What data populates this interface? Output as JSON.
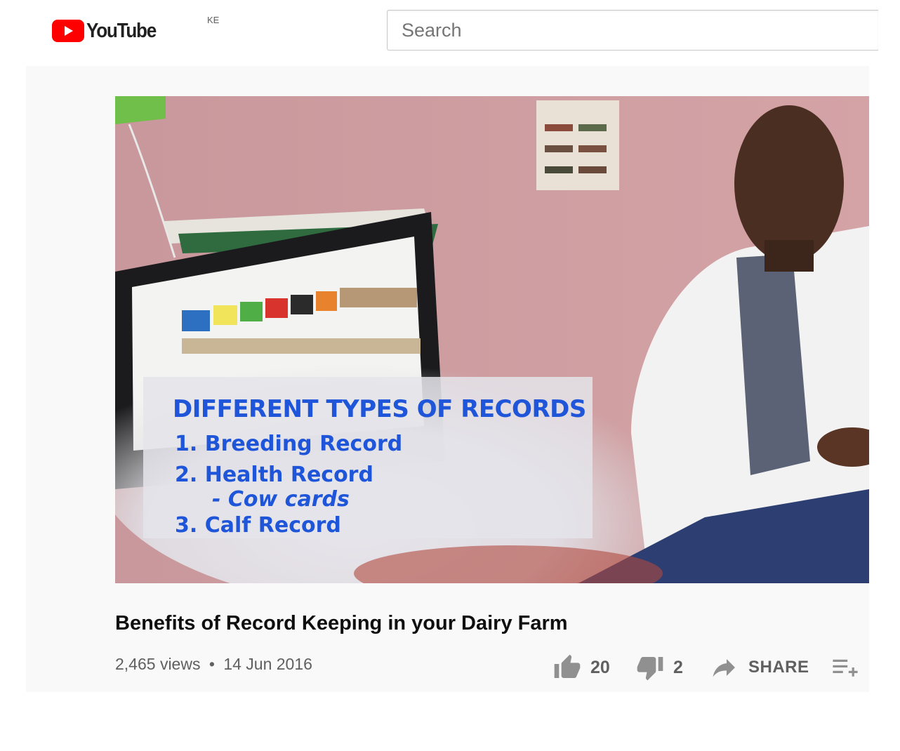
{
  "header": {
    "logo_text": "YouTube",
    "country_code": "KE",
    "search_placeholder": "Search"
  },
  "video": {
    "overlay": {
      "heading": "DIFFERENT TYPES OF RECORDS",
      "item1": "1. Breeding Record",
      "item2": "2. Health Record",
      "item2_sub": "- Cow cards",
      "item3": "3. Calf Record"
    },
    "title": "Benefits of Record Keeping in your Dairy Farm",
    "views": "2,465 views",
    "separator": "•",
    "date": "14 Jun 2016"
  },
  "actions": {
    "likes": "20",
    "dislikes": "2",
    "share_label": "SHARE"
  },
  "icons": {
    "logo": "youtube-play-icon",
    "like": "thumbs-up-icon",
    "dislike": "thumbs-down-icon",
    "share": "share-arrow-icon",
    "save": "add-to-playlist-icon"
  },
  "colors": {
    "brand_red": "#ff0000",
    "overlay_text": "#1f55d8",
    "icon_gray": "#909090"
  }
}
